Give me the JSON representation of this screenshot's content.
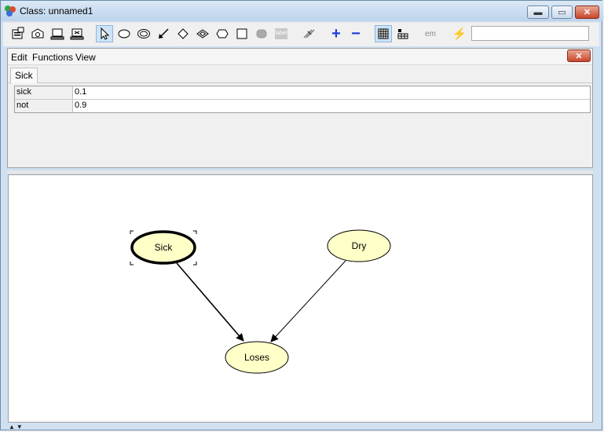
{
  "window": {
    "title": "Class: unnamed1",
    "controls": {
      "minimize": "▬",
      "maximize": "▭",
      "close": "✕"
    }
  },
  "toolbar": {
    "buttons": [
      {
        "name": "properties-icon"
      },
      {
        "name": "open-icon"
      },
      {
        "name": "compile-icon"
      },
      {
        "name": "run-icon"
      },
      {
        "name": "select-pointer-icon",
        "active": true
      },
      {
        "name": "chance-node-icon"
      },
      {
        "name": "discrete-node-icon"
      },
      {
        "name": "link-arrow-icon"
      },
      {
        "name": "decision-node-icon"
      },
      {
        "name": "decision-discrete-icon"
      },
      {
        "name": "utility-node-icon"
      },
      {
        "name": "instance-node-icon"
      },
      {
        "name": "disabled-node-icon"
      },
      {
        "name": "label-icon",
        "text": "label"
      },
      {
        "name": "eliminate-icon"
      },
      {
        "name": "zoom-in-icon",
        "text": "+"
      },
      {
        "name": "zoom-out-icon",
        "text": "−"
      },
      {
        "name": "table-view-icon",
        "active": true
      },
      {
        "name": "layout-icon"
      },
      {
        "name": "em-learning-icon",
        "text": "em"
      },
      {
        "name": "lightning-icon",
        "text": "⚡"
      }
    ],
    "search_value": ""
  },
  "panel": {
    "menu": [
      "Edit",
      "Functions",
      "View"
    ],
    "close_glyph": "✕",
    "tab": "Sick",
    "table": [
      {
        "label": "sick",
        "value": "0.1"
      },
      {
        "label": "not",
        "value": "0.9"
      }
    ]
  },
  "graph": {
    "nodes": [
      {
        "id": "sick",
        "label": "Sick",
        "selected": true
      },
      {
        "id": "dry",
        "label": "Dry",
        "selected": false
      },
      {
        "id": "loses",
        "label": "Loses",
        "selected": false
      }
    ],
    "edges": [
      {
        "from": "Sick",
        "to": "Loses"
      },
      {
        "from": "Dry",
        "to": "Loses"
      }
    ],
    "node_fill": "#ffffc8"
  },
  "colors": {
    "accent": "#1f3fd8",
    "selection": "#cde3f7"
  },
  "status": {
    "arrows": "▲▼"
  }
}
